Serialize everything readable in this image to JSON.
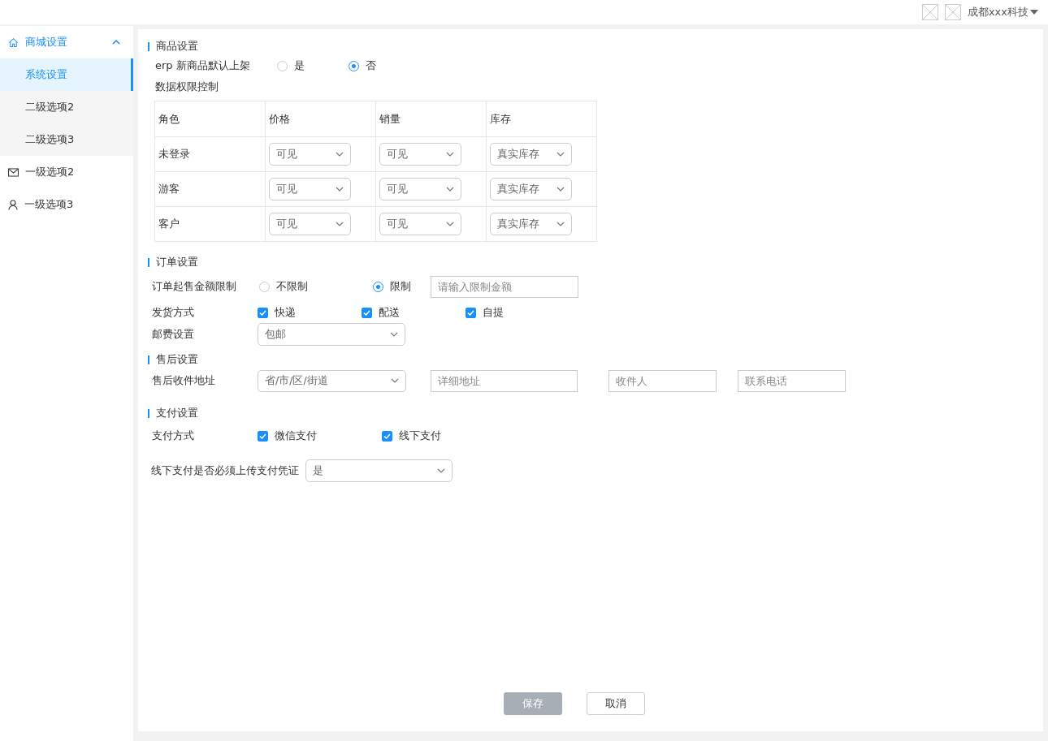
{
  "header": {
    "company": "成都xxx科技"
  },
  "sidebar": {
    "items": [
      {
        "label": "商城设置",
        "expanded": true,
        "children": [
          {
            "label": "系统设置",
            "selected": true
          },
          {
            "label": "二级选项2",
            "selected": false
          },
          {
            "label": "二级选项3",
            "selected": false
          }
        ]
      },
      {
        "label": "一级选项2"
      },
      {
        "label": "一级选项3"
      }
    ]
  },
  "product_settings": {
    "title": "商品设置",
    "auto_list": {
      "label": "erp 新商品默认上架",
      "options": [
        {
          "label": "是",
          "selected": false
        },
        {
          "label": "否",
          "selected": true
        }
      ]
    },
    "permissions": {
      "label": "数据权限控制",
      "columns": [
        "角色",
        "价格",
        "销量",
        "库存"
      ],
      "rows": [
        {
          "role": "未登录",
          "values": [
            "可见",
            "可见",
            "真实库存"
          ]
        },
        {
          "role": "游客",
          "values": [
            "可见",
            "可见",
            "真实库存"
          ]
        },
        {
          "role": "客户",
          "values": [
            "可见",
            "可见",
            "真实库存"
          ]
        }
      ]
    }
  },
  "order_settings": {
    "title": "订单设置",
    "min_amount": {
      "label": "订单起售金额限制",
      "options": [
        {
          "label": "不限制",
          "selected": false
        },
        {
          "label": "限制",
          "selected": true
        }
      ],
      "placeholder": "请输入限制金额"
    },
    "delivery": {
      "label": "发货方式",
      "options": [
        {
          "label": "快递",
          "checked": true
        },
        {
          "label": "配送",
          "checked": true
        },
        {
          "label": "自提",
          "checked": true
        }
      ]
    },
    "shipping_fee": {
      "label": "邮费设置",
      "value": "包邮"
    }
  },
  "after_sales": {
    "title": "售后设置",
    "label": "售后收件地址",
    "region_placeholder": "省/市/区/街道",
    "fields": [
      {
        "placeholder": "详细地址"
      },
      {
        "placeholder": "收件人"
      },
      {
        "placeholder": "联系电话"
      }
    ]
  },
  "payment": {
    "title": "支付设置",
    "methods": {
      "label": "支付方式",
      "options": [
        {
          "label": "微信支付",
          "checked": true
        },
        {
          "label": "线下支付",
          "checked": true
        }
      ]
    },
    "voucher": {
      "label": "线下支付是否必须上传支付凭证",
      "value": "是"
    }
  },
  "buttons": [
    {
      "label": "保存",
      "kind": "primary",
      "disabled": true
    },
    {
      "label": "取消",
      "kind": "default"
    }
  ]
}
